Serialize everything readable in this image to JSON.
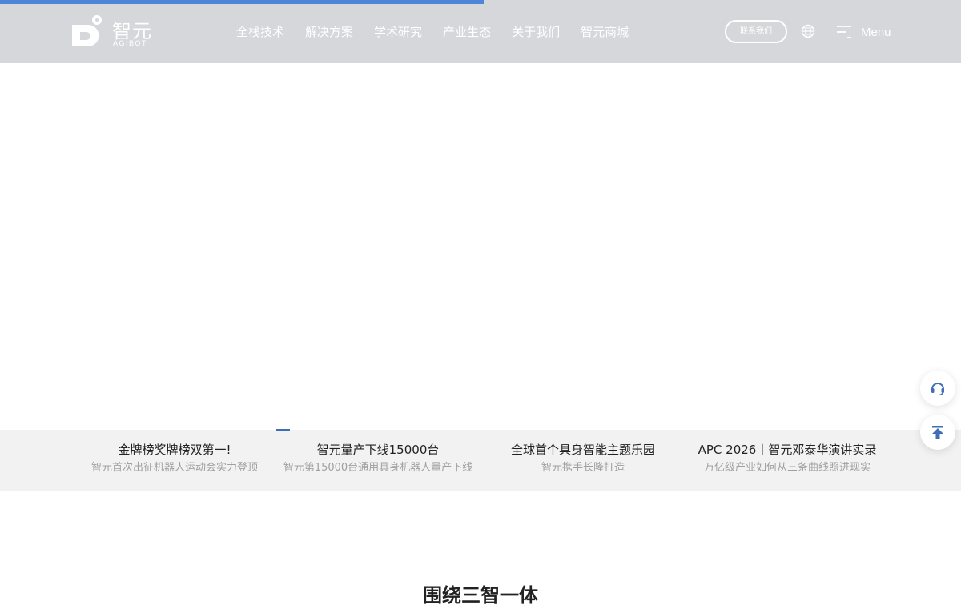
{
  "page_progress": 0.503,
  "brand": {
    "name_cn": "智元",
    "name_en": "AGIBOT",
    "color": "#ffffff"
  },
  "nav": {
    "items": [
      {
        "label": "全栈技术"
      },
      {
        "label": "解决方案"
      },
      {
        "label": "学术研究"
      },
      {
        "label": "产业生态"
      },
      {
        "label": "关于我们"
      },
      {
        "label": "智元商城"
      }
    ],
    "contact_label": "联系我们",
    "language_icon": "globe-icon",
    "menu_icon": "menu-icon",
    "menu_label": "Menu"
  },
  "news": [
    {
      "title": "金牌榜奖牌榜双第一!",
      "subtitle": "智元首次出征机器人运动会实力登顶"
    },
    {
      "title": "智元量产下线15000台",
      "subtitle": "智元第15000台通用具身机器人量产下线"
    },
    {
      "title": "全球首个具身智能主题乐园",
      "subtitle": "智元携手长隆打造"
    },
    {
      "title": "APC 2026丨智元邓泰华演讲实录",
      "subtitle": "万亿级产业如何从三条曲线照进现实"
    }
  ],
  "floating": {
    "support_icon": "headset-icon",
    "top_icon": "back-to-top-icon"
  },
  "section": {
    "title": "围绕三智一体"
  },
  "colors": {
    "header_bg": "#d5d7db",
    "accent": "#3f6eb6",
    "progress": "#4f85d6",
    "strip_bg": "#f2f2f2",
    "title_text": "#222222",
    "muted_text": "#a0a0a0"
  }
}
